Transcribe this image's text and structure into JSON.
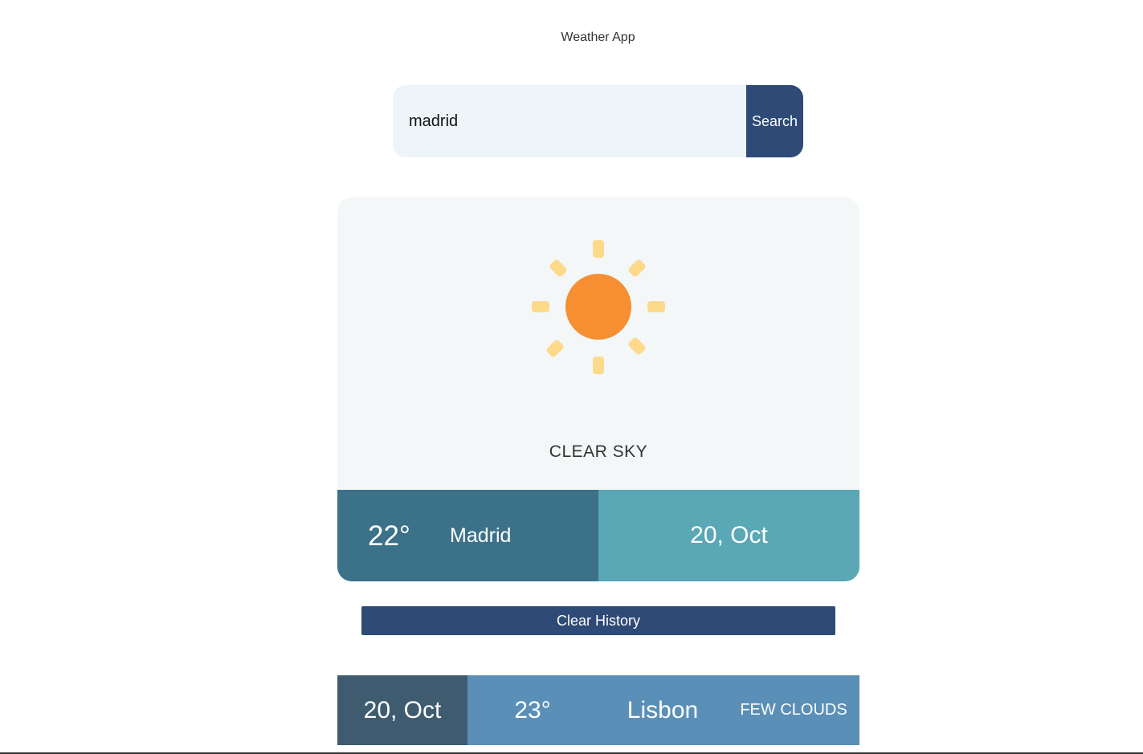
{
  "app": {
    "title": "Weather App"
  },
  "search": {
    "value": "madrid",
    "placeholder": "",
    "button_label": "Search"
  },
  "current": {
    "condition_icon": "sun-icon",
    "condition": "CLEAR SKY",
    "temperature": "22°",
    "city": "Madrid",
    "date": "20, Oct"
  },
  "history": {
    "clear_label": "Clear History",
    "items": [
      {
        "date": "20, Oct",
        "temperature": "23°",
        "city": "Lisbon",
        "condition": "FEW CLOUDS"
      }
    ]
  },
  "colors": {
    "primary": "#2e4a76",
    "card_bg": "#f3f7f8",
    "info_left": "#3b7189",
    "info_right": "#5aa7b5",
    "history_date": "#3f5b70",
    "history_rest": "#5a8fb7",
    "sun_core": "#f68e32",
    "sun_rays": "#fdd98a"
  }
}
